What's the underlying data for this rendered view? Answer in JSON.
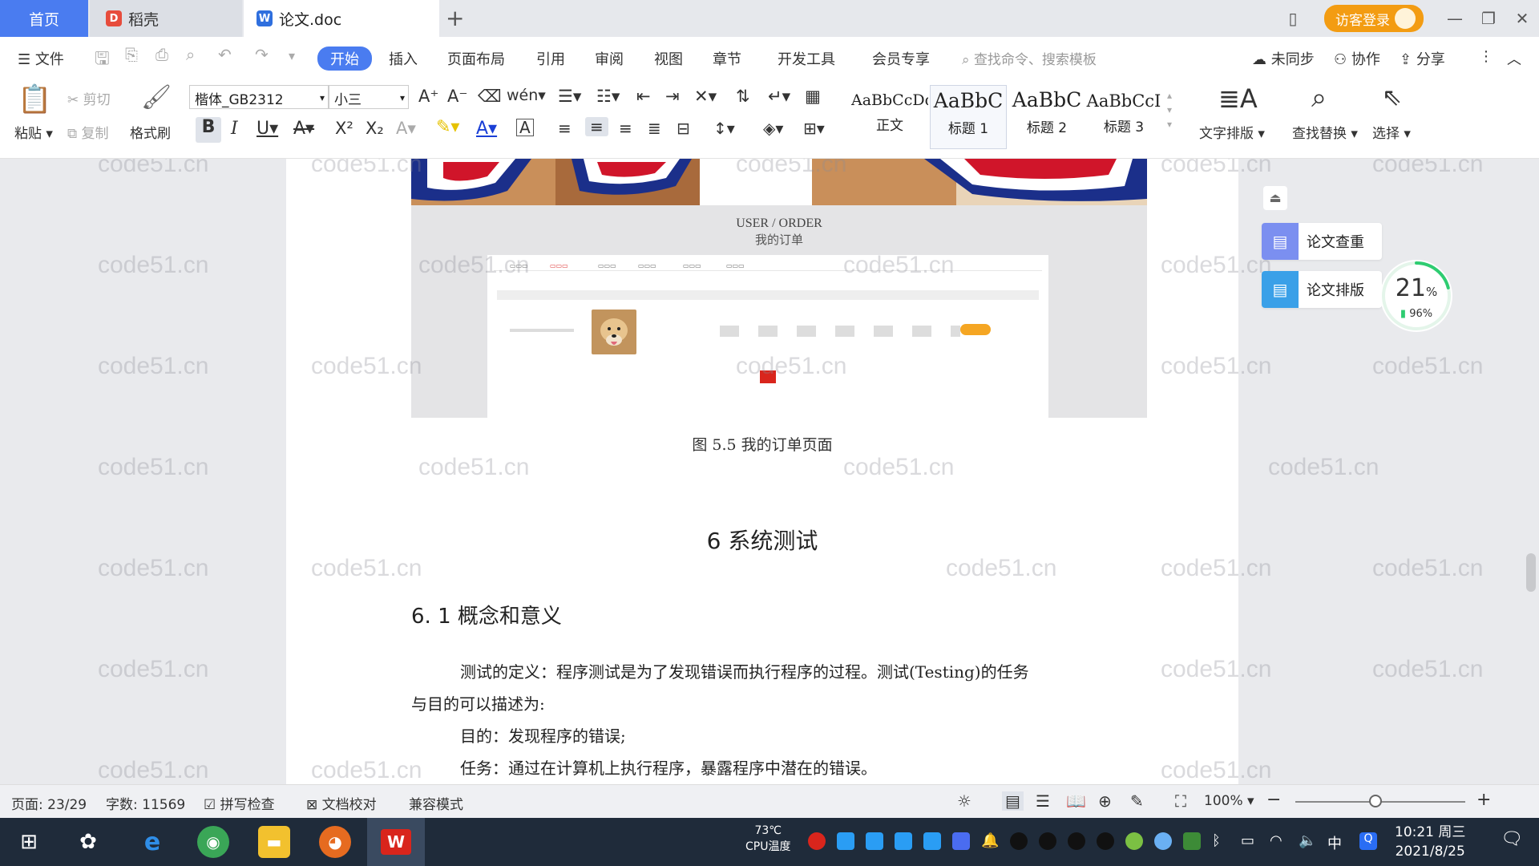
{
  "tabs": {
    "home": "首页",
    "daoke": "稻壳",
    "doc": "论文.doc"
  },
  "titlebar": {
    "login": "访客登录"
  },
  "menu": {
    "file": "文件",
    "items": [
      "开始",
      "插入",
      "页面布局",
      "引用",
      "审阅",
      "视图",
      "章节",
      "开发工具",
      "会员专享"
    ],
    "search": "查找命令、搜索模板",
    "sync": "未同步",
    "collab": "协作",
    "share": "分享"
  },
  "ribbon": {
    "paste": "粘贴",
    "cut": "剪切",
    "copy": "复制",
    "format_painter": "格式刷",
    "font": "楷体_GB2312",
    "size": "小三",
    "styles": [
      {
        "sample": "AaBbCcDd",
        "name": "正文"
      },
      {
        "sample": "AaBbC",
        "name": "标题 1"
      },
      {
        "sample": "AaBbC",
        "name": "标题 2"
      },
      {
        "sample": "AaBbCcI",
        "name": "标题 3"
      }
    ],
    "text_layout": "文字排版",
    "find_replace": "查找替换",
    "select": "选择"
  },
  "document": {
    "screenshot_title_en": "USER / ORDER",
    "screenshot_title_cn": "我的订单",
    "caption": "图 5.5 我的订单页面",
    "chapter": "6 系统测试",
    "section": "6. 1 概念和意义",
    "para1": "测试的定义：程序测试是为了发现错误而执行程序的过程。测试(Testing)的任务",
    "para2": "与目的可以描述为:",
    "para3": "目的：发现程序的错误;",
    "para4": "任务：通过在计算机上执行程序，暴露程序中潜在的错误。"
  },
  "right_panel": {
    "check": "论文查重",
    "layout": "论文排版",
    "gauge_value": "21",
    "gauge_unit": "%",
    "battery": "96%"
  },
  "status": {
    "page": "页面: 23/29",
    "words": "字数: 11569",
    "spell": "拼写检查",
    "proof": "文档校对",
    "compat": "兼容模式",
    "zoom": "100%"
  },
  "taskbar": {
    "cpu_value": "73℃",
    "cpu_label": "CPU温度",
    "time": "10:21 周三",
    "date": "2021/8/25",
    "ime": "中"
  },
  "watermark": "code51.cn",
  "colors": {
    "accent": "#4a7cf0",
    "login": "#f39c12",
    "gauge": "#2ecc71"
  }
}
